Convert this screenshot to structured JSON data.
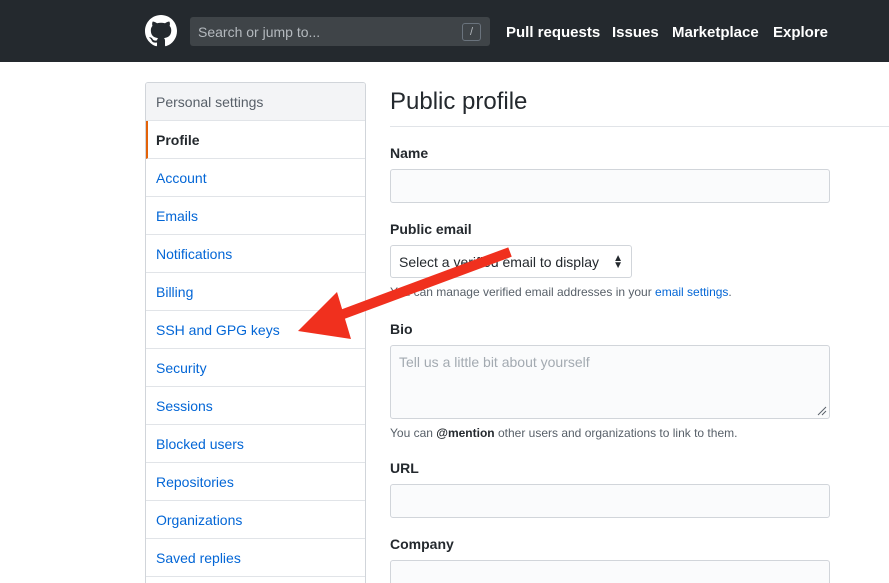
{
  "header": {
    "search_placeholder": "Search or jump to...",
    "search_key": "/",
    "nav": [
      "Pull requests",
      "Issues",
      "Marketplace",
      "Explore"
    ]
  },
  "sidebar": {
    "heading": "Personal settings",
    "items": [
      {
        "label": "Profile",
        "selected": true
      },
      {
        "label": "Account"
      },
      {
        "label": "Emails"
      },
      {
        "label": "Notifications"
      },
      {
        "label": "Billing"
      },
      {
        "label": "SSH and GPG keys"
      },
      {
        "label": "Security"
      },
      {
        "label": "Sessions"
      },
      {
        "label": "Blocked users"
      },
      {
        "label": "Repositories"
      },
      {
        "label": "Organizations"
      },
      {
        "label": "Saved replies"
      }
    ]
  },
  "main": {
    "title": "Public profile",
    "name_label": "Name",
    "name_value": "",
    "email_label": "Public email",
    "email_select": "Select a verified email to display",
    "email_note_prefix": "You can manage verified email addresses in your ",
    "email_note_link": "email settings",
    "email_note_suffix": ".",
    "bio_label": "Bio",
    "bio_placeholder": "Tell us a little bit about yourself",
    "bio_note_prefix": "You can ",
    "bio_note_mention": "@mention",
    "bio_note_suffix": " other users and organizations to link to them.",
    "url_label": "URL",
    "url_value": "",
    "company_label": "Company"
  },
  "colors": {
    "header_bg": "#24292e",
    "link": "#0366d6",
    "selected_accent": "#e36209",
    "annotation_arrow": "#f0301e"
  },
  "icons": {
    "logo": "github-octocat-icon",
    "select_caret": "up-down-caret-icon",
    "annotation": "red-arrow-annotation"
  }
}
